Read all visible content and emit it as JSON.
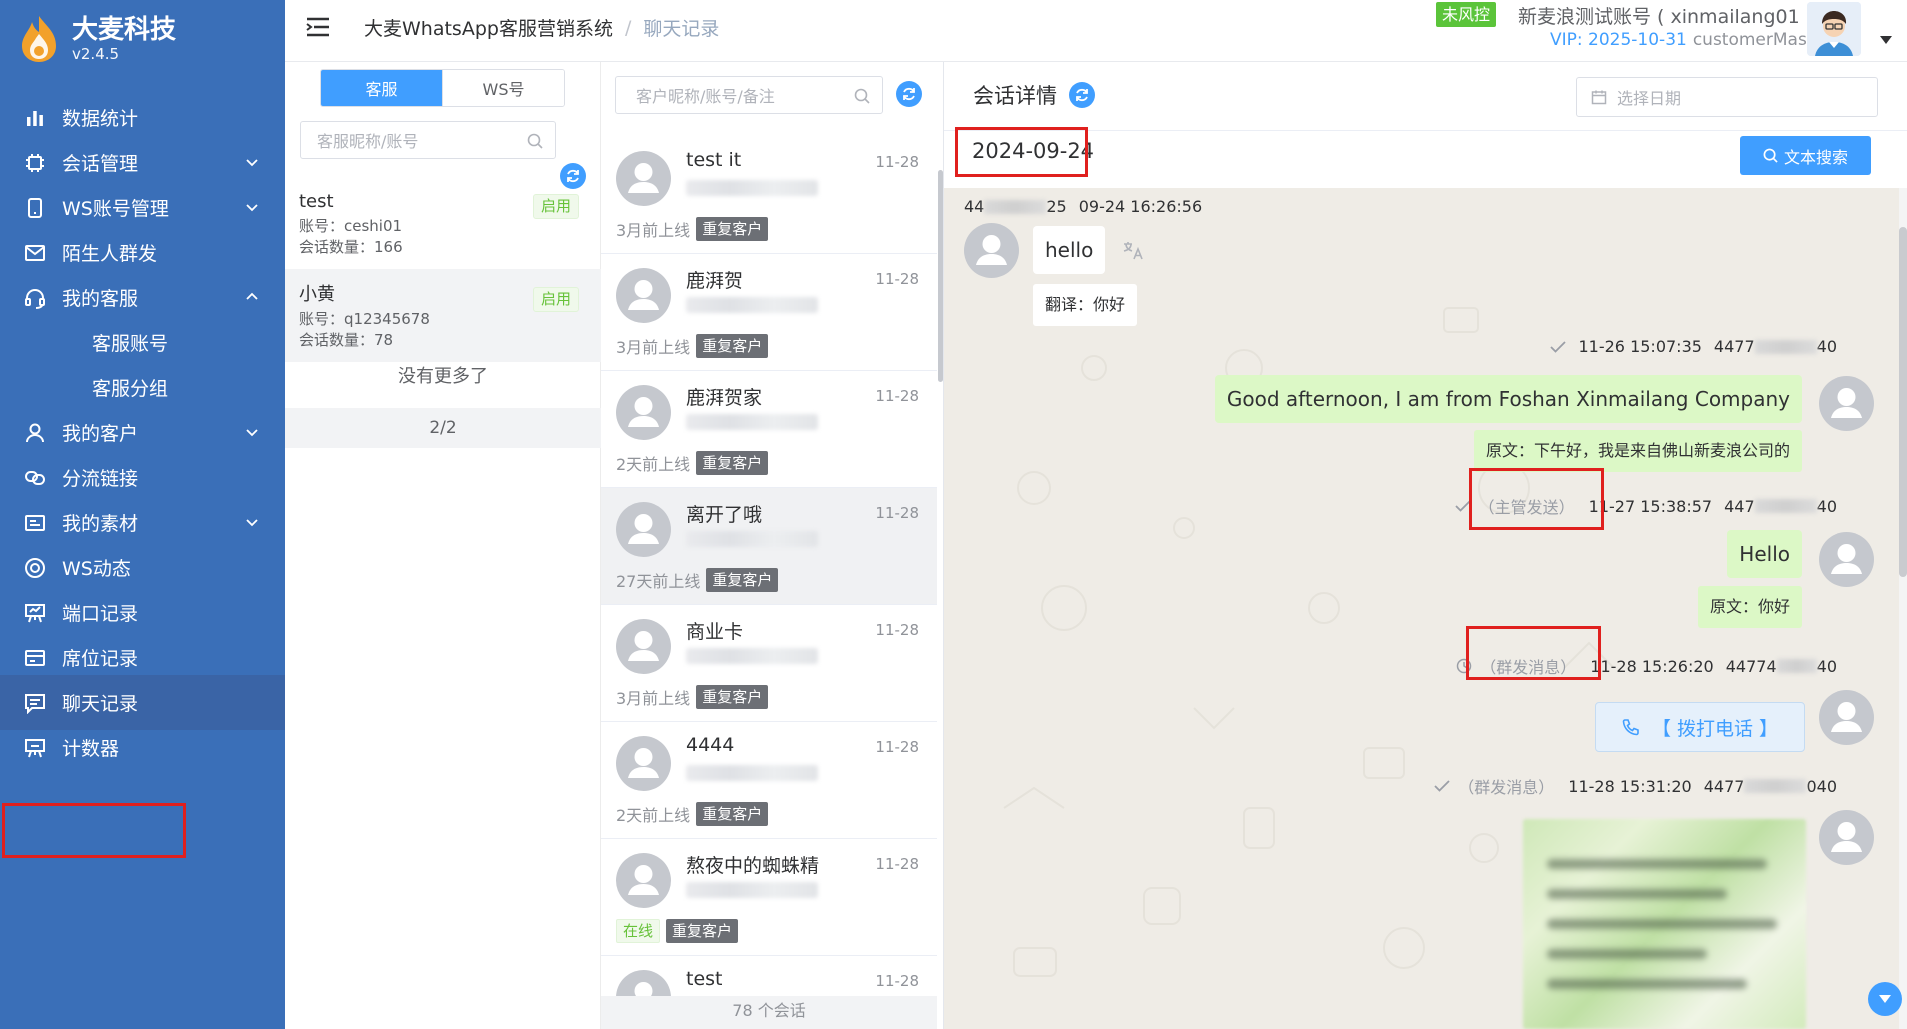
{
  "brand": {
    "name": "大麦科技",
    "version": "v2.4.5"
  },
  "sidebar": {
    "items": [
      {
        "label": "数据统计"
      },
      {
        "label": "会话管理"
      },
      {
        "label": "WS账号管理"
      },
      {
        "label": "陌生人群发"
      },
      {
        "label": "我的客服"
      },
      {
        "label": "客服账号"
      },
      {
        "label": "客服分组"
      },
      {
        "label": "我的客户"
      },
      {
        "label": "分流链接"
      },
      {
        "label": "我的素材"
      },
      {
        "label": "WS动态"
      },
      {
        "label": "端口记录"
      },
      {
        "label": "席位记录"
      },
      {
        "label": "聊天记录"
      },
      {
        "label": "计数器"
      }
    ]
  },
  "header": {
    "breadcrumb": [
      "大麦WhatsApp客服营销系统",
      "聊天记录"
    ],
    "breadcrumb_sep": "/",
    "risk_tag": "未风控",
    "account": "新麦浪测试账号 ( xinmailang01 )",
    "vip": "VIP: 2025-10-31",
    "role": "customerMaster"
  },
  "agents": {
    "tabs": [
      "客服",
      "WS号"
    ],
    "search_placeholder": "客服昵称/账号",
    "list": [
      {
        "name": "test",
        "account": "账号：ceshi01",
        "sessions": "会话数量：166",
        "status": "启用"
      },
      {
        "name": "小黄",
        "account": "账号：q12345678",
        "sessions": "会话数量：78",
        "status": "启用"
      }
    ],
    "no_more": "没有更多了",
    "pager": "2/2"
  },
  "conversations": {
    "search_placeholder": "客户昵称/账号/备注",
    "list": [
      {
        "name": "test it",
        "time": "11-28",
        "last_online": "3月前上线",
        "tag": "重复客户"
      },
      {
        "name": "鹿湃贺",
        "time": "11-28",
        "last_online": "3月前上线",
        "tag": "重复客户"
      },
      {
        "name": "鹿湃贺家",
        "time": "11-28",
        "last_online": "2天前上线",
        "tag": "重复客户"
      },
      {
        "name": "离开了哦",
        "time": "11-28",
        "last_online": "27天前上线",
        "tag": "重复客户"
      },
      {
        "name": "商业卡",
        "time": "11-28",
        "last_online": "3月前上线",
        "tag": "重复客户"
      },
      {
        "name": "4444",
        "time": "11-28",
        "last_online": "2天前上线",
        "tag": "重复客户"
      },
      {
        "name": "熬夜中的蜘蛛精",
        "time": "11-28",
        "online": "在线",
        "tag": "重复客户"
      },
      {
        "name": "test",
        "time": "11-28"
      }
    ],
    "count": "78 个会话"
  },
  "chat": {
    "title": "会话详情",
    "date_placeholder": "选择日期",
    "current_date": "2024-09-24",
    "text_search": "文本搜索",
    "messages": [
      {
        "prefix": "44",
        "suffix": "25",
        "time": "09-24 16:26:56",
        "text": "hello",
        "translation": "翻译：你好"
      },
      {
        "time": "11-26 15:07:35",
        "number_prefix": "4477",
        "number_suffix": "40",
        "text": "Good afternoon, I am from Foshan Xinmailang Company",
        "original": "原文：下午好，我是来自佛山新麦浪公司的"
      },
      {
        "label": "（主管发送）",
        "time": "11-27 15:38:57",
        "number_prefix": "447",
        "number_suffix": "40",
        "text": "Hello",
        "original": "原文：你好"
      },
      {
        "label": "（群发消息）",
        "time": "11-28 15:26:20",
        "number_prefix": "44774",
        "number_suffix": "40",
        "call": "【 拨打电话 】"
      },
      {
        "label": "（群发消息）",
        "time": "11-28 15:31:20",
        "number_prefix": "4477",
        "number_suffix": "040"
      }
    ]
  },
  "colors": {
    "sidebar": "#3a6fb8",
    "accent": "#409eff",
    "success": "#67c23a",
    "highlight_box": "#e0201e",
    "outgoing_bubble": "#dcf8c6"
  }
}
